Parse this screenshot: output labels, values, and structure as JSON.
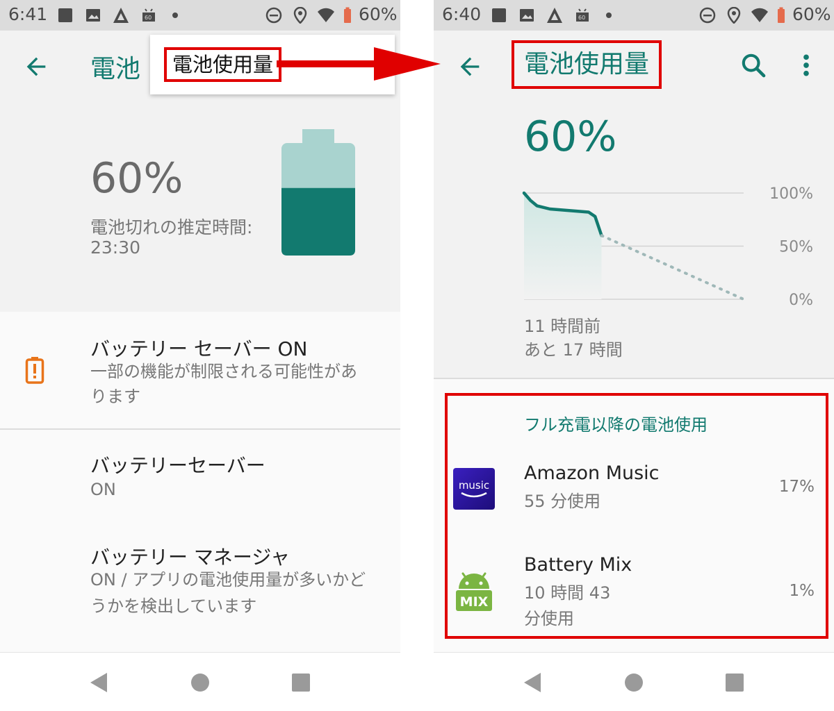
{
  "colors": {
    "accent": "#127a6f",
    "annotation_red": "#e00000",
    "battery_light": "#a9d3cf",
    "warning_orange": "#e8741a"
  },
  "left": {
    "status": {
      "time": "6:41",
      "battery_text": "60%",
      "icons": [
        "square-icon",
        "image-icon",
        "delta-icon",
        "android-60-icon",
        "dot-icon",
        "dnd-icon",
        "location-icon",
        "wifi-icon",
        "battery-icon"
      ]
    },
    "appbar": {
      "title": "電池"
    },
    "popup": {
      "item": "電池使用量"
    },
    "battery": {
      "percent": "60%",
      "estimate_label": "電池切れの推定時間:",
      "estimate_time": "23:30",
      "level": 0.6
    },
    "rows": [
      {
        "title": "バッテリー セーバー ON",
        "sub1": "一部の機能が制限される可能性があ",
        "sub2": "ります"
      },
      {
        "title": "バッテリーセーバー",
        "sub1": "ON"
      },
      {
        "title": "バッテリー マネージャ",
        "sub1": "ON / アプリの電池使用量が多いかど",
        "sub2": "うかを検出しています"
      }
    ]
  },
  "right": {
    "status": {
      "time": "6:40",
      "battery_text": "60%"
    },
    "appbar": {
      "title": "電池使用量"
    },
    "header": {
      "percent": "60%",
      "foot1": "11 時間前",
      "foot2": "あと 17 時間"
    },
    "chart_data": {
      "type": "area",
      "ylim": [
        0,
        100
      ],
      "yticks": [
        "100%",
        "50%",
        "0%"
      ],
      "series": [
        {
          "x": [
            0,
            0.5,
            1,
            2,
            3,
            4,
            5,
            5.5,
            6
          ],
          "values": [
            100,
            93,
            88,
            85,
            84,
            83,
            82,
            78,
            60
          ]
        }
      ],
      "projection": {
        "x": [
          6,
          17
        ],
        "values": [
          60,
          0
        ]
      }
    },
    "usage": {
      "section_title": "フル充電以降の電池使用",
      "apps": [
        {
          "icon_text": "music",
          "name": "Amazon Music",
          "sub1": "55 分使用",
          "pct": "17%"
        },
        {
          "icon_text": "MIX",
          "name": "Battery Mix",
          "sub1": "10 時間 43",
          "sub2": "分使用",
          "pct": "1%"
        }
      ]
    }
  }
}
